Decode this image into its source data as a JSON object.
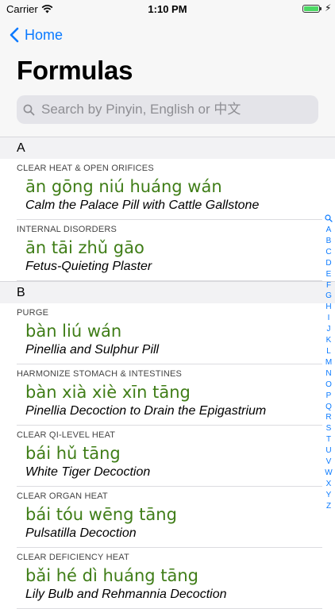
{
  "status_bar": {
    "carrier": "Carrier",
    "time": "1:10 PM",
    "battery_level": 1.0
  },
  "nav": {
    "back_label": "Home",
    "title": "Formulas"
  },
  "search": {
    "placeholder": "Search by Pinyin, English or 中文"
  },
  "colors": {
    "accent": "#0a7aff",
    "pinyin": "#3f7d17",
    "battery": "#4cd964"
  },
  "sections": [
    {
      "letter": "A",
      "rows": [
        {
          "category": "CLEAR HEAT & OPEN ORIFICES",
          "pinyin": "ān gōng niú huáng wán",
          "english": "Calm the Palace Pill with Cattle Gallstone"
        },
        {
          "category": "INTERNAL DISORDERS",
          "pinyin": "ān tāi zhǔ gāo",
          "english": "Fetus-Quieting Plaster"
        }
      ]
    },
    {
      "letter": "B",
      "rows": [
        {
          "category": "PURGE",
          "pinyin": "bàn liú wán",
          "english": "Pinellia and Sulphur Pill"
        },
        {
          "category": "HARMONIZE STOMACH & INTESTINES",
          "pinyin": "bàn xià xiè xīn tāng",
          "english": "Pinellia Decoction to Drain the Epigastrium"
        },
        {
          "category": "CLEAR QI-LEVEL HEAT",
          "pinyin": "bái hǔ tāng",
          "english": "White Tiger Decoction"
        },
        {
          "category": "CLEAR ORGAN HEAT",
          "pinyin": "bái tóu wēng tāng",
          "english": "Pulsatilla Decoction"
        },
        {
          "category": "CLEAR DEFICIENCY HEAT",
          "pinyin": "bǎi hé dì huáng tāng",
          "english": "Lily Bulb and Rehmannia Decoction"
        }
      ]
    }
  ],
  "index_letters": [
    "A",
    "B",
    "C",
    "D",
    "E",
    "F",
    "G",
    "H",
    "I",
    "J",
    "K",
    "L",
    "M",
    "N",
    "O",
    "P",
    "Q",
    "R",
    "S",
    "T",
    "U",
    "V",
    "W",
    "X",
    "Y",
    "Z"
  ]
}
